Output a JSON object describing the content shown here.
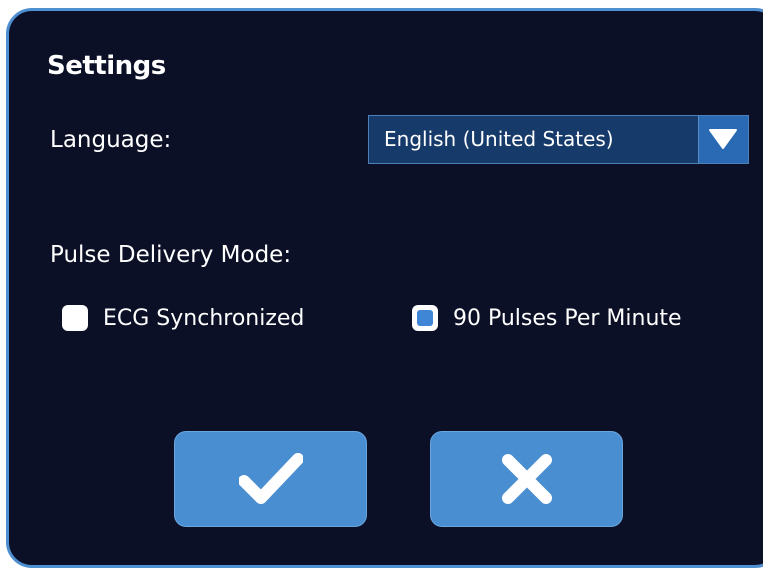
{
  "dialog": {
    "title": "Settings"
  },
  "language": {
    "label": "Language:",
    "selected": "English (United States)",
    "dropdown_icon": "triangle-down-icon"
  },
  "pulse_delivery": {
    "label": "Pulse Delivery Mode:",
    "options": [
      {
        "label": "ECG Synchronized",
        "checked": false
      },
      {
        "label": "90 Pulses Per Minute",
        "checked": true
      }
    ]
  },
  "buttons": {
    "confirm_icon": "checkmark-icon",
    "cancel_icon": "close-icon"
  },
  "colors": {
    "background": "#0b1026",
    "border": "#4d8fd0",
    "button": "#4a8ed2",
    "dropdown": "#163a6a",
    "checked_fill": "#3f86d6",
    "text": "#ffffff"
  }
}
